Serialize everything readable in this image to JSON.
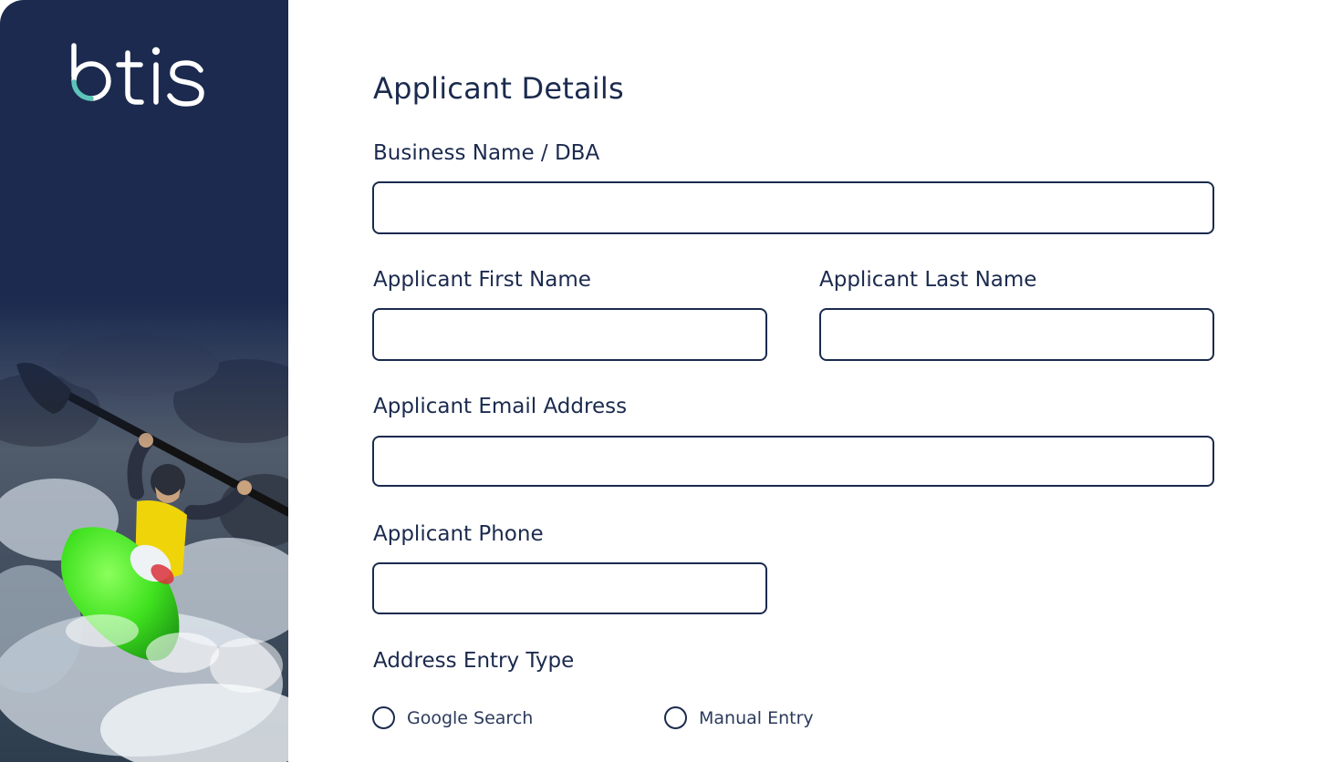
{
  "brand": {
    "name": "btis",
    "bar_color": "#1b2a4e",
    "accent_color": "#5cc4b8"
  },
  "form": {
    "title": "Applicant Details",
    "fields": {
      "business_name": {
        "label": "Business Name / DBA",
        "value": ""
      },
      "first_name": {
        "label": "Applicant First Name",
        "value": ""
      },
      "last_name": {
        "label": "Applicant Last Name",
        "value": ""
      },
      "email": {
        "label": "Applicant Email Address",
        "value": ""
      },
      "phone": {
        "label": "Applicant Phone",
        "value": ""
      }
    },
    "address_entry": {
      "label": "Address Entry Type",
      "options": [
        "Google Search",
        "Manual Entry"
      ],
      "selected": null
    }
  }
}
